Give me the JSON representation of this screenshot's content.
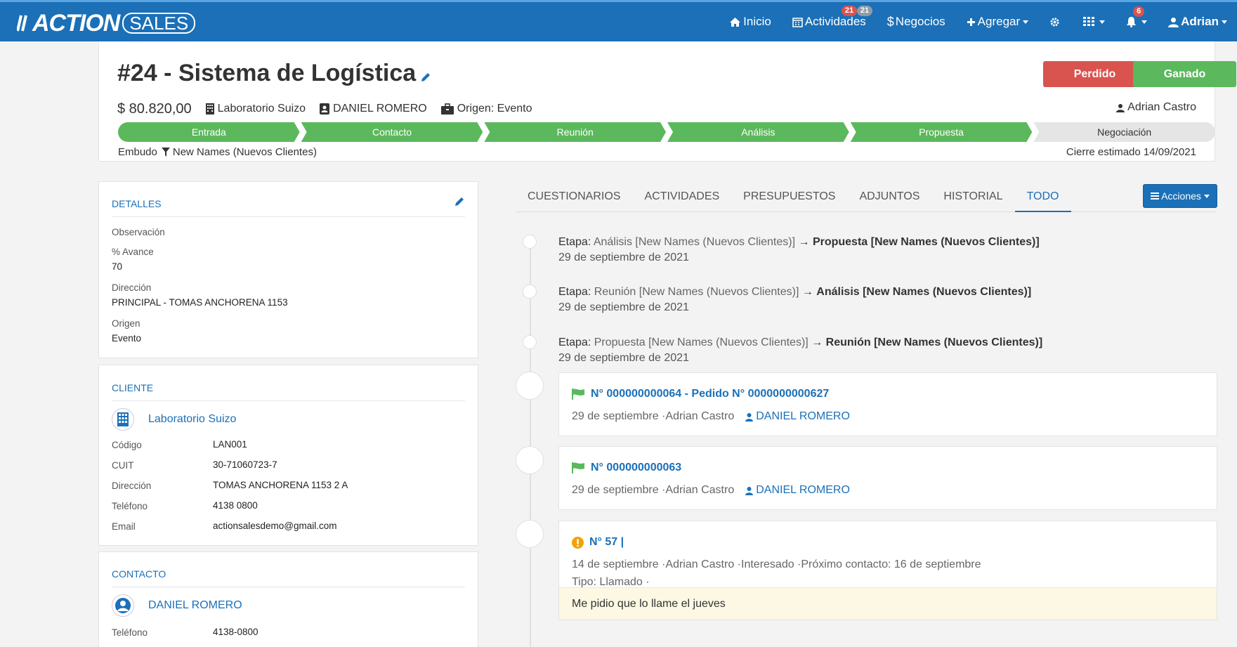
{
  "brand": {
    "logo_left": "ACTION",
    "logo_right": "SALES"
  },
  "nav": {
    "inicio": "Inicio",
    "actividades": "Actividades",
    "actividades_badge_1": "21",
    "actividades_badge_2": "21",
    "negocios": "Negocios",
    "agregar": "Agregar",
    "notif_badge": "6",
    "user": "Adrian"
  },
  "deal": {
    "title": "#24 - Sistema de Logística",
    "amount": "$ 80.820,00",
    "company": "Laboratorio Suizo",
    "contact": "DANIEL ROMERO",
    "origin": "Origen: Evento",
    "owner": "Adrian Castro",
    "btn_lost": "Perdido",
    "btn_won": "Ganado",
    "funnel_label": "Embudo",
    "funnel_name": "New Names (Nuevos Clientes)",
    "close_label": "Cierre estimado",
    "close_date": "14/09/2021",
    "stages": [
      {
        "label": "Entrada",
        "done": true
      },
      {
        "label": "Contacto",
        "done": true
      },
      {
        "label": "Reunión",
        "done": true
      },
      {
        "label": "Análisis",
        "done": true
      },
      {
        "label": "Propuesta",
        "done": true
      },
      {
        "label": "Negociación",
        "done": false
      }
    ]
  },
  "details": {
    "title": "DETALLES",
    "observacion_label": "Observación",
    "avance_label": "% Avance",
    "avance_value": "70",
    "direccion_label": "Dirección",
    "direccion_value": "PRINCIPAL - TOMAS ANCHORENA 1153",
    "origen_label": "Origen",
    "origen_value": "Evento"
  },
  "cliente": {
    "title": "CLIENTE",
    "name": "Laboratorio Suizo",
    "rows": [
      {
        "label": "Código",
        "value": "LAN001"
      },
      {
        "label": "CUIT",
        "value": "30-71060723-7"
      },
      {
        "label": "Dirección",
        "value": "TOMAS ANCHORENA 1153 2 A"
      },
      {
        "label": "Teléfono",
        "value": "4138 0800"
      },
      {
        "label": "Email",
        "value": "actionsalesdemo@gmail.com"
      }
    ]
  },
  "contacto": {
    "title": "CONTACTO",
    "name": "DANIEL ROMERO",
    "telefono_label": "Teléfono",
    "telefono_value": "4138-0800"
  },
  "tabs": [
    "CUESTIONARIOS",
    "ACTIVIDADES",
    "PRESUPUESTOS",
    "ADJUNTOS",
    "HISTORIAL",
    "TODO"
  ],
  "actions_button": "Acciones",
  "timeline": {
    "stage_events": [
      {
        "prefix": "Etapa:",
        "from": "Análisis [New Names (Nuevos Clientes)]",
        "arrow": "→",
        "to": "Propuesta [New Names (Nuevos Clientes)]",
        "date": "29 de septiembre de 2021"
      },
      {
        "prefix": "Etapa:",
        "from": "Reunión [New Names (Nuevos Clientes)]",
        "arrow": "→",
        "to": "Análisis [New Names (Nuevos Clientes)]",
        "date": "29 de septiembre de 2021"
      },
      {
        "prefix": "Etapa:",
        "from": "Propuesta [New Names (Nuevos Clientes)]",
        "arrow": "→",
        "to": "Reunión [New Names (Nuevos Clientes)]",
        "date": "29 de septiembre de 2021"
      }
    ],
    "card1": {
      "title": "N° 000000000064  -  Pedido N° 0000000000627",
      "meta": "29 de septiembre ·Adrian Castro",
      "contact": "DANIEL ROMERO"
    },
    "card2": {
      "title": "N° 000000000063",
      "meta": "29 de septiembre ·Adrian Castro",
      "contact": "DANIEL ROMERO"
    },
    "card3": {
      "title": "N° 57 |",
      "meta": "14 de septiembre ·Adrian Castro ·Interesado ·Próximo contacto: 16 de septiembre",
      "tipo": "Tipo: Llamado ·",
      "note": "Me pidio que lo llame el jueves"
    }
  },
  "colors": {
    "primary": "#1b70b8",
    "danger": "#d9534f",
    "success": "#5cb85c",
    "note_bg": "#fcf8e3"
  }
}
